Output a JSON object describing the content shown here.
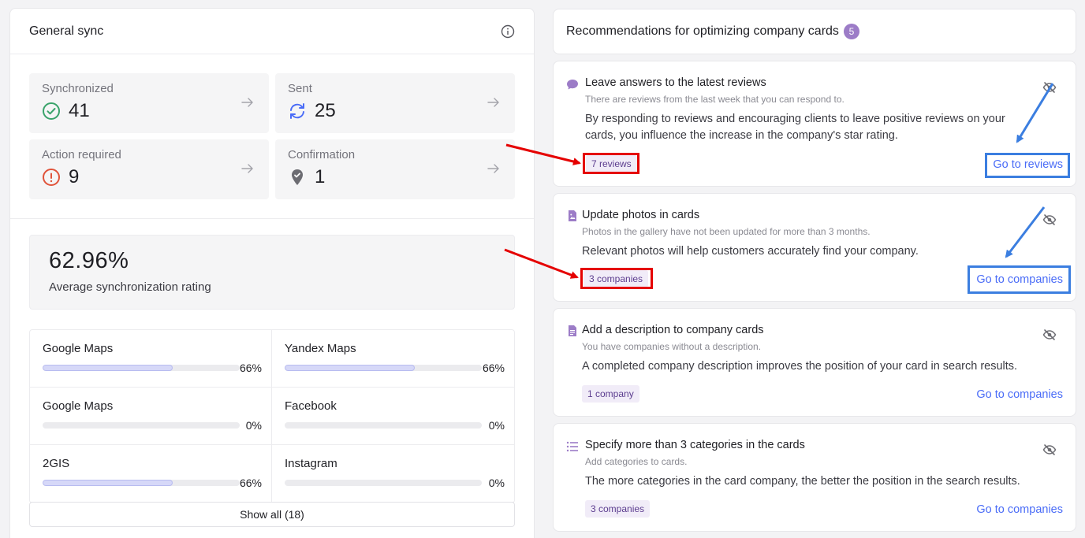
{
  "general_sync": {
    "title": "General sync",
    "stats": [
      {
        "label": "Synchronized",
        "value": "41",
        "icon": "check-circle-icon",
        "color": "#3aa36b"
      },
      {
        "label": "Sent",
        "value": "25",
        "icon": "sync-icon",
        "color": "#4a6cf7"
      },
      {
        "label": "Action required",
        "value": "9",
        "icon": "alert-circle-icon",
        "color": "#e0533a"
      },
      {
        "label": "Confirmation",
        "value": "1",
        "icon": "map-pin-check-icon",
        "color": "#6c6c72"
      }
    ],
    "rating": {
      "value": "62.96%",
      "label": "Average synchronization rating"
    },
    "platforms": [
      {
        "name": "Google Maps",
        "percent_label": "66%",
        "fill": 0.66
      },
      {
        "name": "Yandex Maps",
        "percent_label": "66%",
        "fill": 0.66
      },
      {
        "name": "Google Maps",
        "percent_label": "0%",
        "fill": 0
      },
      {
        "name": "Facebook",
        "percent_label": "0%",
        "fill": 0
      },
      {
        "name": "2GIS",
        "percent_label": "66%",
        "fill": 0.66
      },
      {
        "name": "Instagram",
        "percent_label": "0%",
        "fill": 0
      }
    ],
    "show_all": "Show all (18)"
  },
  "recommendations": {
    "title": "Recommendations for optimizing company cards",
    "count": "5",
    "cards": [
      {
        "icon": "chat-bubble-icon",
        "title": "Leave answers to the latest reviews",
        "subtitle": "There are reviews from the last week that you can respond to.",
        "description_1": "By responding to reviews and encouraging clients to leave positive reviews on your",
        "description_2": "cards, you influence the increase in the company's star rating.",
        "badge": "7 reviews",
        "link": "Go to reviews"
      },
      {
        "icon": "image-file-icon",
        "title": "Update photos in cards",
        "subtitle": "Photos in the gallery have not been updated for more than 3 months.",
        "description_1": "Relevant photos will help customers accurately find your company.",
        "badge": "3 companies",
        "link": "Go to companies"
      },
      {
        "icon": "document-icon",
        "title": "Add a description to company cards",
        "subtitle": "You have companies without a description.",
        "description_1": "A completed company description improves the position of your card in search results.",
        "badge": "1 company",
        "link": "Go to companies"
      },
      {
        "icon": "list-icon",
        "title": "Specify more than 3 categories in the cards",
        "subtitle": "Add categories to cards.",
        "description_1": "The more categories in the card company, the better the position in the search results.",
        "badge": "3 companies",
        "link": "Go to companies"
      }
    ]
  },
  "colors": {
    "accent": "#4a6cf7",
    "purple": "#9c7cc7",
    "annotation_red": "#e50000",
    "annotation_blue": "#3b7ee0"
  }
}
